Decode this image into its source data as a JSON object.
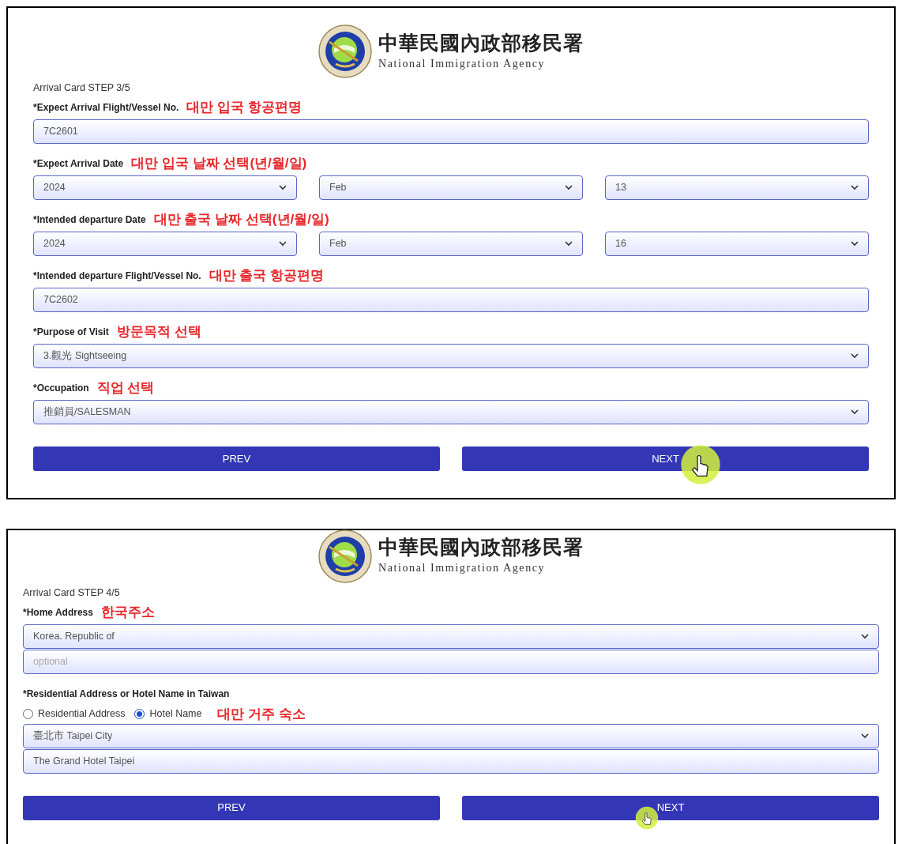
{
  "panels": [
    {
      "header": {
        "title": "中華民國內政部移民署",
        "subtitle": "National Immigration Agency"
      },
      "step": "Arrival Card STEP 3/5",
      "fields": [
        {
          "kind": "text",
          "label": "*Expect Arrival Flight/Vessel No.",
          "annotation": "대만 입국 항공편명",
          "controls": [
            {
              "kind": "input",
              "value": "7C2601"
            }
          ]
        },
        {
          "kind": "date",
          "label": "*Expect Arrival Date",
          "annotation": "대만 입국 날짜 선택(년/월/일)",
          "controls": [
            {
              "kind": "select",
              "value": "2024"
            },
            {
              "kind": "select",
              "value": "Feb"
            },
            {
              "kind": "select",
              "value": "13"
            }
          ]
        },
        {
          "kind": "date",
          "label": "*Intended departure Date",
          "annotation": "대만 출국 날짜 선택(년/월/일)",
          "controls": [
            {
              "kind": "select",
              "value": "2024"
            },
            {
              "kind": "select",
              "value": "Feb"
            },
            {
              "kind": "select",
              "value": "16"
            }
          ]
        },
        {
          "kind": "text",
          "label": "*Intended departure Flight/Vessel No.",
          "annotation": "대만 출국 항공편명",
          "controls": [
            {
              "kind": "input",
              "value": "7C2602"
            }
          ]
        },
        {
          "kind": "text",
          "label": "*Purpose of Visit",
          "annotation": "방문목적 선택",
          "controls": [
            {
              "kind": "select",
              "value": "3.觀光 Sightseeing"
            }
          ]
        },
        {
          "kind": "text",
          "label": "*Occupation",
          "annotation": "직업 선택",
          "controls": [
            {
              "kind": "select",
              "value": "推銷員/SALESMAN"
            }
          ]
        }
      ],
      "buttons": [
        {
          "label": "PREV",
          "cursor": false
        },
        {
          "label": "NEXT",
          "cursor": true
        }
      ]
    },
    {
      "header": {
        "title": "中華民國內政部移民署",
        "subtitle": "National Immigration Agency"
      },
      "step": "Arrival Card STEP 4/5",
      "fields": [
        {
          "kind": "text",
          "label": "*Home Address",
          "annotation": "한국주소",
          "controls": [
            {
              "kind": "select",
              "value": "Korea. Republic of"
            },
            {
              "kind": "input",
              "placeholder": "optional"
            }
          ]
        },
        {
          "kind": "text",
          "label": "*Residential Address or Hotel Name in Taiwan",
          "controls": [
            {
              "kind": "radio_group",
              "annotation": "대만 거주 숙소",
              "options": [
                {
                  "label": "Residential Address",
                  "selected": false
                },
                {
                  "label": "Hotel Name",
                  "selected": true
                }
              ]
            },
            {
              "kind": "select",
              "value": "臺北市 Taipei City"
            },
            {
              "kind": "input",
              "value": "The Grand Hotel Taipei"
            }
          ]
        }
      ],
      "buttons": [
        {
          "label": "PREV",
          "cursor": false
        },
        {
          "label": "NEXT",
          "cursor": true
        }
      ]
    }
  ]
}
